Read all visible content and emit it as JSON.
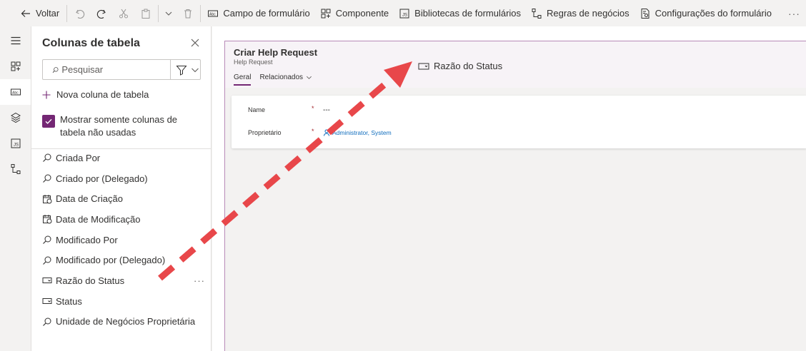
{
  "toolbar": {
    "back_label": "Voltar",
    "commands": [
      {
        "label": "Campo de formulário",
        "icon": "field-icon"
      },
      {
        "label": "Componente",
        "icon": "component-icon"
      },
      {
        "label": "Bibliotecas de formulários",
        "icon": "js-library-icon"
      },
      {
        "label": "Regras de negócios",
        "icon": "business-rules-icon"
      },
      {
        "label": "Configurações do formulário",
        "icon": "form-settings-icon"
      }
    ]
  },
  "rail": {
    "items": [
      "menu-icon",
      "components-icon",
      "table-columns-icon",
      "tree-view-icon",
      "form-libraries-icon",
      "business-rules-icon"
    ],
    "active_index": 2
  },
  "panel": {
    "title": "Colunas de tabela",
    "search": {
      "placeholder": "Pesquisar",
      "value": ""
    },
    "new_column_label": "Nova coluna de tabela",
    "show_unused": {
      "label": "Mostrar somente colunas de tabela não usadas",
      "checked": true
    },
    "columns": [
      {
        "label": "Criada Por",
        "icon": "lookup-icon"
      },
      {
        "label": "Criado por (Delegado)",
        "icon": "lookup-icon"
      },
      {
        "label": "Data de Criação",
        "icon": "calendar-icon"
      },
      {
        "label": "Data de Modificação",
        "icon": "calendar-icon"
      },
      {
        "label": "Modificado Por",
        "icon": "lookup-icon"
      },
      {
        "label": "Modificado por (Delegado)",
        "icon": "lookup-icon"
      },
      {
        "label": "Razão do Status",
        "icon": "option-set-icon",
        "more": "···"
      },
      {
        "label": "Status",
        "icon": "option-set-icon"
      },
      {
        "label": "Unidade de Negócios Proprietária",
        "icon": "lookup-icon"
      }
    ]
  },
  "form": {
    "title": "Criar Help Request",
    "subtitle": "Help Request",
    "tabs": [
      {
        "label": "Geral",
        "active": true
      },
      {
        "label": "Relacionados",
        "active": false,
        "has_menu": true
      }
    ],
    "dragged_field": "Razão do Status",
    "fields": [
      {
        "label": "Name",
        "required": "*",
        "value": "---"
      },
      {
        "label": "Proprietário",
        "required": "*",
        "value": "Administrator, System",
        "is_lookup": true
      }
    ]
  },
  "colors": {
    "accent": "#742774",
    "arrow": "#e8474a",
    "link": "#0f6cbd",
    "required": "#a4262c"
  }
}
